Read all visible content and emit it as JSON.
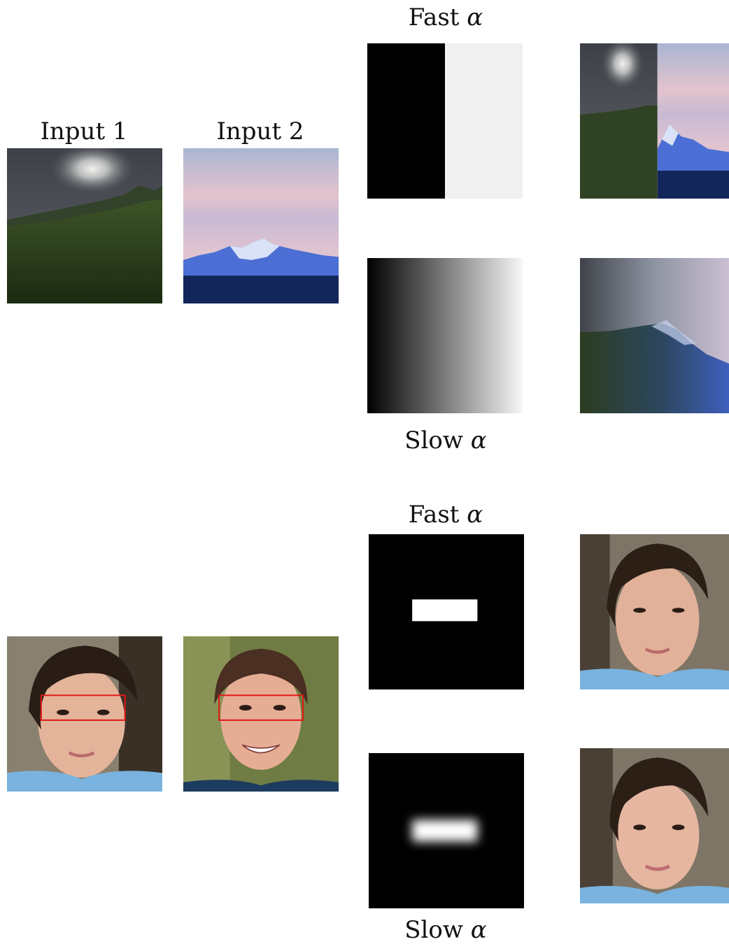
{
  "figure": {
    "top_block": {
      "input1_label": "Input 1",
      "input2_label": "Input 2",
      "fast_label_text": "Fast ",
      "slow_label_text": "Slow ",
      "alpha_symbol": "α"
    },
    "bottom_block": {
      "fast_label_text": "Fast ",
      "slow_label_text": "Slow ",
      "alpha_symbol": "α"
    }
  }
}
